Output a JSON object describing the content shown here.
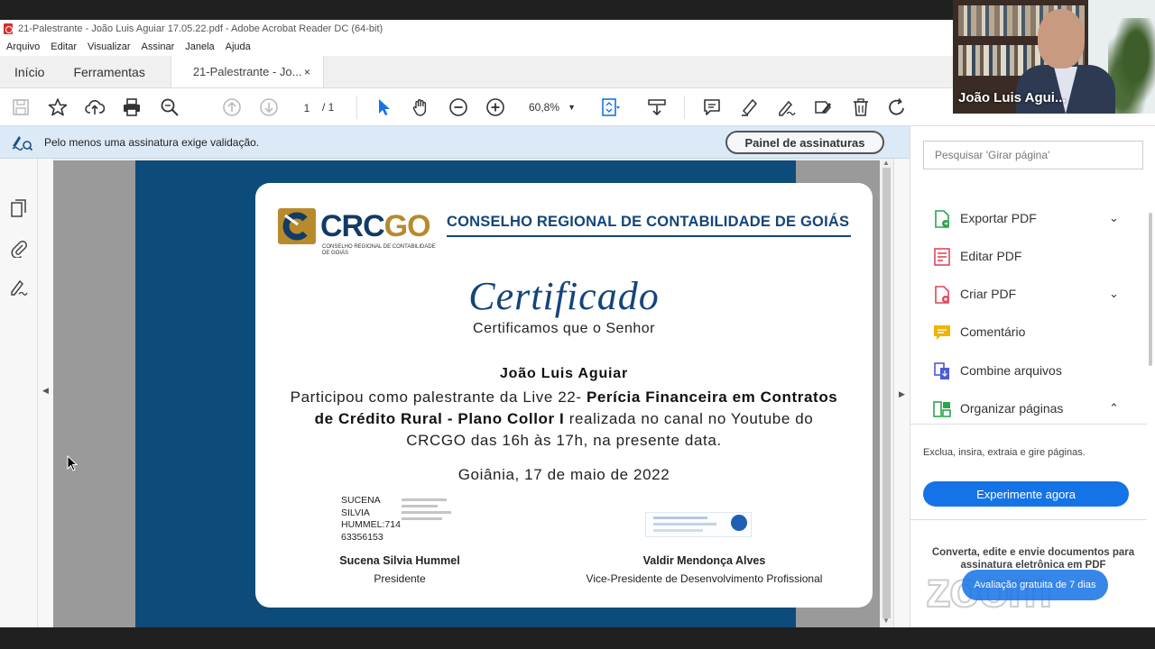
{
  "window": {
    "title": "21-Palestrante - João Luis Aguiar 17.05.22.pdf - Adobe Acrobat Reader DC (64-bit)"
  },
  "menu": [
    "Arquivo",
    "Editar",
    "Visualizar",
    "Assinar",
    "Janela",
    "Ajuda"
  ],
  "tabs": {
    "home": "Início",
    "tools": "Ferramentas",
    "doc": "21-Palestrante - Jo...",
    "close": "×"
  },
  "toolbar": {
    "page_current": "1",
    "page_total": "/ 1",
    "zoom": "60,8%"
  },
  "signature_bar": {
    "message": "Pelo menos uma assinatura exige validação.",
    "panel_button": "Painel de assinaturas"
  },
  "certificate": {
    "org_logo": "CRCGO",
    "org_logo_sub": "CONSELHO REGIONAL DE CONTABILIDADE DE GOIÁS",
    "org_header": "CONSELHO REGIONAL DE CONTABILIDADE DE GOIÁS",
    "title": "Certificado",
    "intro": "Certificamos que o Senhor",
    "name": "João Luis Aguiar",
    "body_1": "Participou como palestrante da Live 22-",
    "body_bold": "Perícia Financeira em Contratos de Crédito Rural - Plano Collor I",
    "body_2": "realizada no canal no Youtube do CRCGO das 16h às 17h, na presente data.",
    "date": "Goiânia, 17 de maio de 2022",
    "signer1_stamp": [
      "SUCENA",
      "SILVIA",
      "HUMMEL:714",
      "63356153"
    ],
    "signer1_name": "Sucena Silvia Hummel",
    "signer1_role": "Presidente",
    "signer2_name": "Valdir Mendonça Alves",
    "signer2_role": "Vice-Presidente de Desenvolvimento Profissional"
  },
  "right_panel": {
    "search_placeholder": "Pesquisar 'Girar página'",
    "tools": [
      {
        "label": "Exportar PDF",
        "chevron": "⌄",
        "color": "#2da44e"
      },
      {
        "label": "Editar PDF",
        "chevron": "",
        "color": "#e0475b"
      },
      {
        "label": "Criar PDF",
        "chevron": "⌄",
        "color": "#e0475b"
      },
      {
        "label": "Comentário",
        "chevron": "",
        "color": "#f0b400"
      },
      {
        "label": "Combine arquivos",
        "chevron": "",
        "color": "#4a5bd4"
      },
      {
        "label": "Organizar páginas",
        "chevron": "⌃",
        "color": "#2da44e"
      }
    ],
    "tool_desc": "Exclua, insira, extraia e gire páginas.",
    "try_button": "Experimente agora",
    "promo": "Converta, edite e envie documentos para assinatura eletrônica em PDF"
  },
  "overlay": {
    "zoom_logo": "zoom",
    "trial_pill": "Avaliação gratuita de 7 dias",
    "participant_name": "João Luis Agui..."
  },
  "colors": {
    "accent": "#1473e6",
    "cert_frame": "#0d4b7a",
    "cert_blue": "#14457a",
    "cert_gold": "#b78a2c"
  }
}
